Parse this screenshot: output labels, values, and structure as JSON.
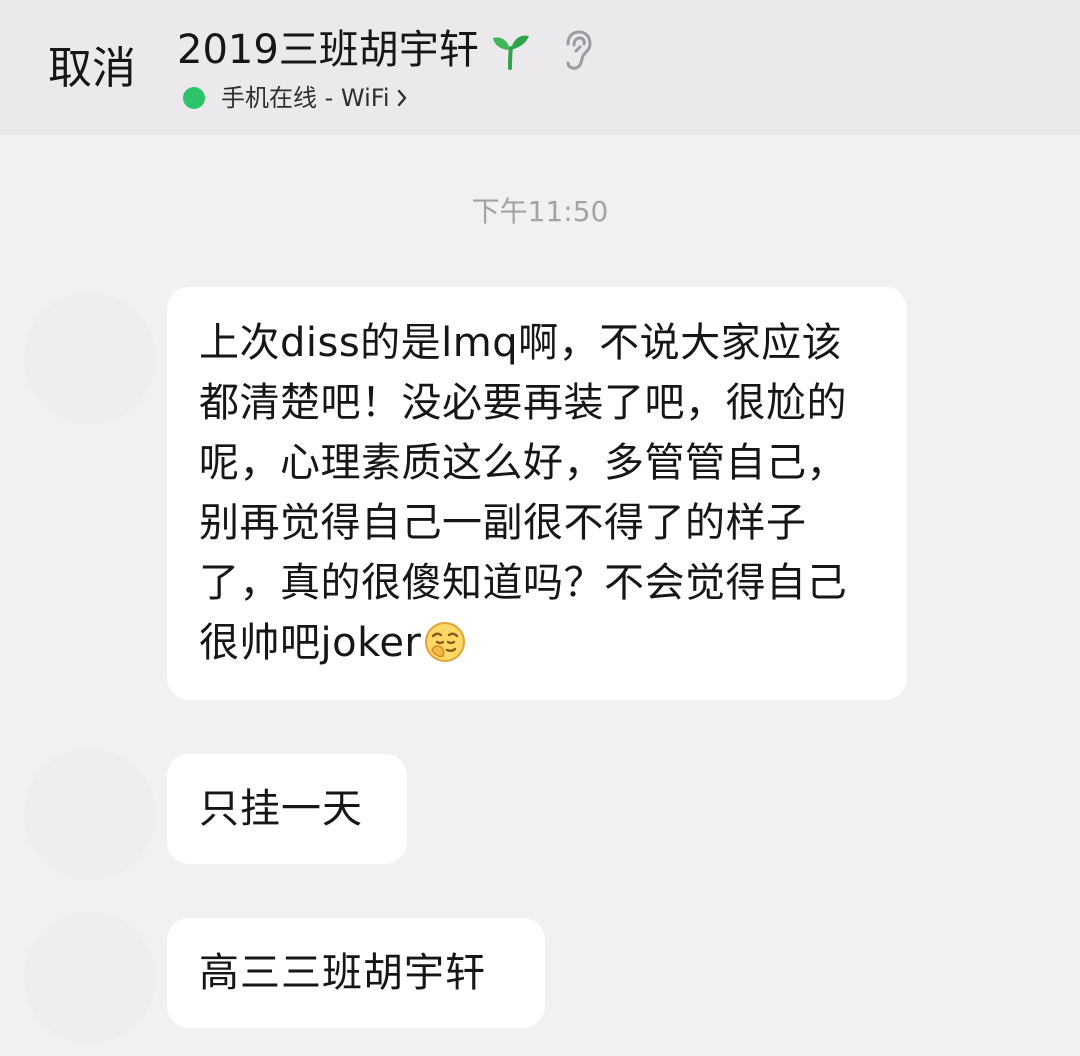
{
  "header": {
    "cancel_label": "取消",
    "contact_name": "2019三班胡宇轩",
    "status_text": "手机在线 - WiFi",
    "status_color": "#2cc36b",
    "name_badge_icon": "sprout-icon",
    "mode_icon": "ear-icon",
    "status_chevron_icon": "chevron-right-icon"
  },
  "chat": {
    "timestamp": "下午11:50",
    "messages": [
      {
        "sender": "2019三班胡宇轩",
        "text": "上次diss的是lmq啊，不说大家应该都清楚吧！没必要再装了吧，很尬的呢，心理素质这么好，多管管自己，别再觉得自己一副很不得了的样子了，真的很傻知道吗？不会觉得自己很帅吧joker",
        "trailing_emoji": "smirk-emoji-icon"
      },
      {
        "sender": "2019三班胡宇轩",
        "text": "只挂一天"
      },
      {
        "sender": "2019三班胡宇轩",
        "text": "高三三班胡宇轩"
      }
    ]
  }
}
